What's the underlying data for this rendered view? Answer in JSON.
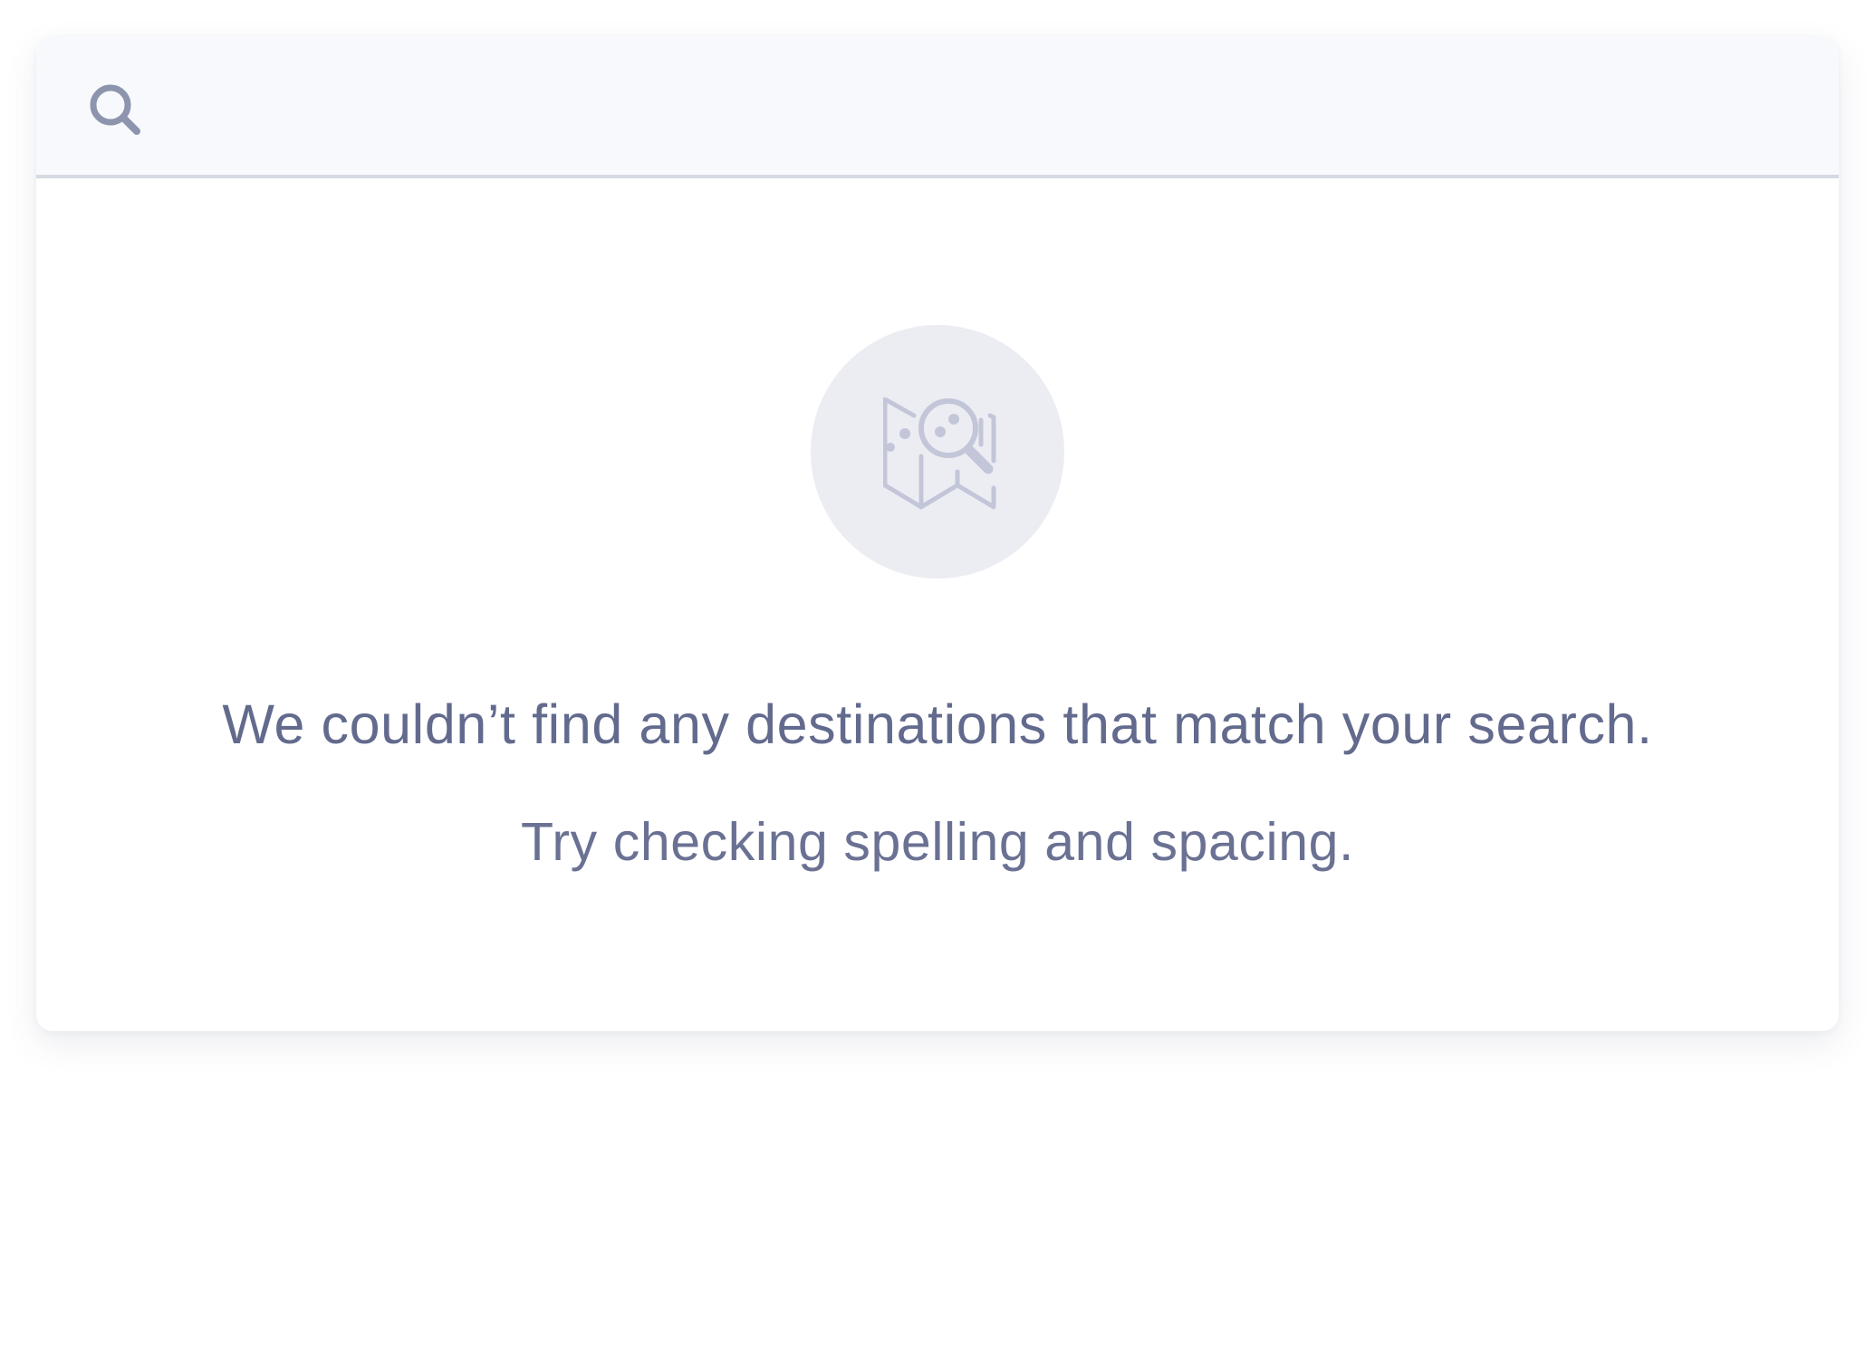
{
  "search": {
    "value": "",
    "placeholder": "",
    "icon": "search-icon"
  },
  "empty_state": {
    "icon": "map-search-icon",
    "title": "We couldn’t find any destinations that match your search.",
    "subtitle": "Try checking spelling and spacing."
  },
  "colors": {
    "search_bar_bg": "#f8f9fd",
    "divider": "#d5d9e2",
    "icon_circle_bg": "#ecedf3",
    "icon_stroke": "#c3c6d8",
    "search_icon": "#8d95ae",
    "text": "#626a8d"
  }
}
